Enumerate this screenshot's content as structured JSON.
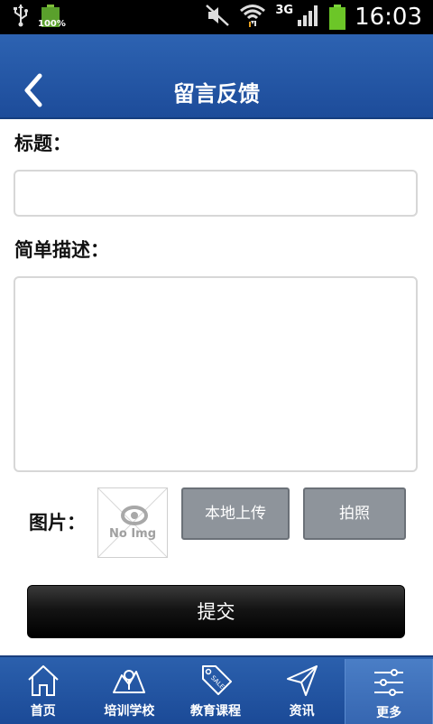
{
  "status_bar": {
    "battery_small_pct": "100%",
    "network": "3G",
    "time": "16:03"
  },
  "header": {
    "title": "留言反馈"
  },
  "form": {
    "title_label": "标题：",
    "title_value": "",
    "description_label": "简单描述：",
    "description_value": "",
    "image_label": "图片：",
    "no_image_text": "No Img",
    "upload_local_label": "本地上传",
    "take_photo_label": "拍照",
    "submit_label": "提交"
  },
  "bottom_nav": {
    "items": [
      {
        "label": "首页",
        "icon": "home-icon"
      },
      {
        "label": "培训学校",
        "icon": "school-icon"
      },
      {
        "label": "教育课程",
        "icon": "sale-tag-icon"
      },
      {
        "label": "资讯",
        "icon": "paper-plane-icon"
      },
      {
        "label": "更多",
        "icon": "sliders-icon"
      }
    ],
    "active_index": 4
  },
  "colors": {
    "header_blue": "#2358a6",
    "button_gray": "#8e949b",
    "submit_black": "#111111"
  }
}
